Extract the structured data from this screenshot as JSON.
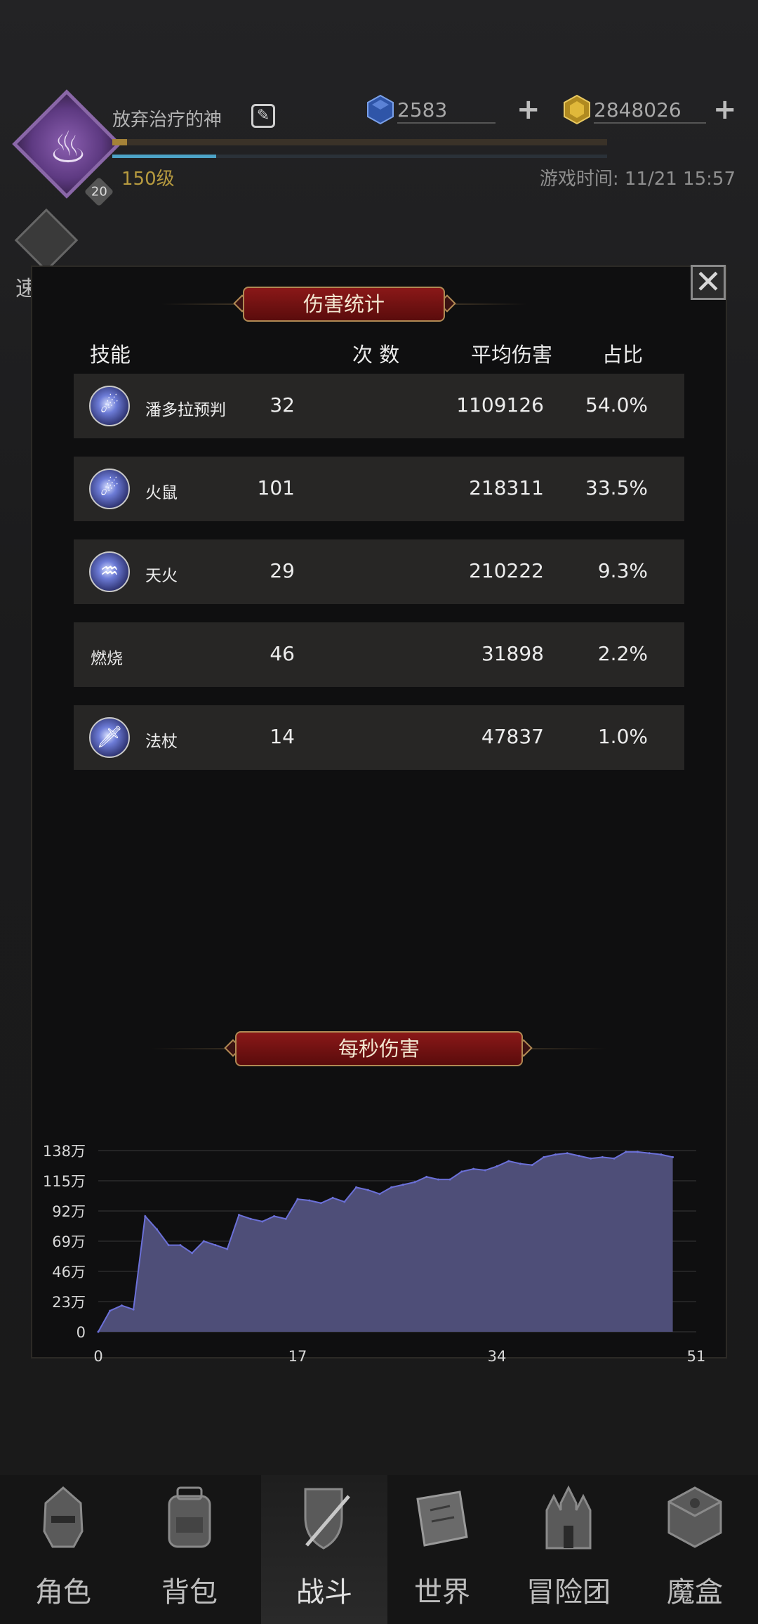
{
  "player": {
    "name": "放弃治疗的神",
    "avatar_badge": "20",
    "level": "150级",
    "xp_progress": 0.03,
    "hp_progress": 0.21
  },
  "currency": {
    "gems": "2583",
    "gold": "2848026"
  },
  "game_time": "游戏时间: 11/21 15:57",
  "quick_battle_label": "速 战",
  "damage_panel": {
    "title": "伤害统计",
    "headers": {
      "skill": "技能",
      "count": "次 数",
      "avg": "平均伤害",
      "share": "占比"
    },
    "rows": [
      {
        "name": "潘多拉预判",
        "count": "32",
        "avg": "1109126",
        "share": "54.0%",
        "icon": "fire-orb-icon"
      },
      {
        "name": "火鼠",
        "count": "101",
        "avg": "218311",
        "share": "33.5%",
        "icon": "fire-orb-icon"
      },
      {
        "name": "天火",
        "count": "29",
        "avg": "210222",
        "share": "9.3%",
        "icon": "flame-icon"
      },
      {
        "name": "燃烧",
        "count": "46",
        "avg": "31898",
        "share": "2.2%",
        "icon": ""
      },
      {
        "name": "法杖",
        "count": "14",
        "avg": "47837",
        "share": "1.0%",
        "icon": "sword-icon"
      }
    ]
  },
  "dps_panel": {
    "title": "每秒伤害"
  },
  "chart_data": {
    "type": "area",
    "title": "每秒伤害",
    "xlabel": "",
    "ylabel": "",
    "xlim": [
      0,
      51
    ],
    "ylim": [
      0,
      138
    ],
    "x_ticks": [
      "0",
      "17",
      "34",
      "51"
    ],
    "y_ticks": [
      "0",
      "23万",
      "46万",
      "69万",
      "92万",
      "115万",
      "138万"
    ],
    "grid": true,
    "x": [
      0,
      1,
      2,
      3,
      4,
      5,
      6,
      7,
      8,
      9,
      10,
      11,
      12,
      13,
      14,
      15,
      16,
      17,
      18,
      19,
      20,
      21,
      22,
      23,
      24,
      25,
      26,
      27,
      28,
      29,
      30,
      31,
      32,
      33,
      34,
      35,
      36,
      37,
      38,
      39,
      40,
      41,
      42,
      43,
      44,
      45,
      46,
      47,
      48,
      49
    ],
    "values": [
      0,
      16,
      20,
      17,
      88,
      78,
      66,
      66,
      60,
      69,
      66,
      63,
      89,
      86,
      84,
      88,
      86,
      101,
      100,
      98,
      102,
      99,
      110,
      108,
      105,
      110,
      112,
      114,
      118,
      116,
      116,
      122,
      124,
      123,
      126,
      130,
      128,
      127,
      133,
      135,
      136,
      134,
      132,
      133,
      132,
      137,
      137,
      136,
      135,
      133
    ],
    "colors": {
      "fill": "#4e4e78",
      "line": "#6b70d8"
    }
  },
  "nav": [
    {
      "label": "角色",
      "icon": "helmet-icon"
    },
    {
      "label": "背包",
      "icon": "backpack-icon"
    },
    {
      "label": "战斗",
      "icon": "sword-shield-icon"
    },
    {
      "label": "世界",
      "icon": "map-scroll-icon"
    },
    {
      "label": "冒险团",
      "icon": "castle-icon"
    },
    {
      "label": "魔盒",
      "icon": "cube-icon"
    }
  ],
  "active_nav": "战斗"
}
